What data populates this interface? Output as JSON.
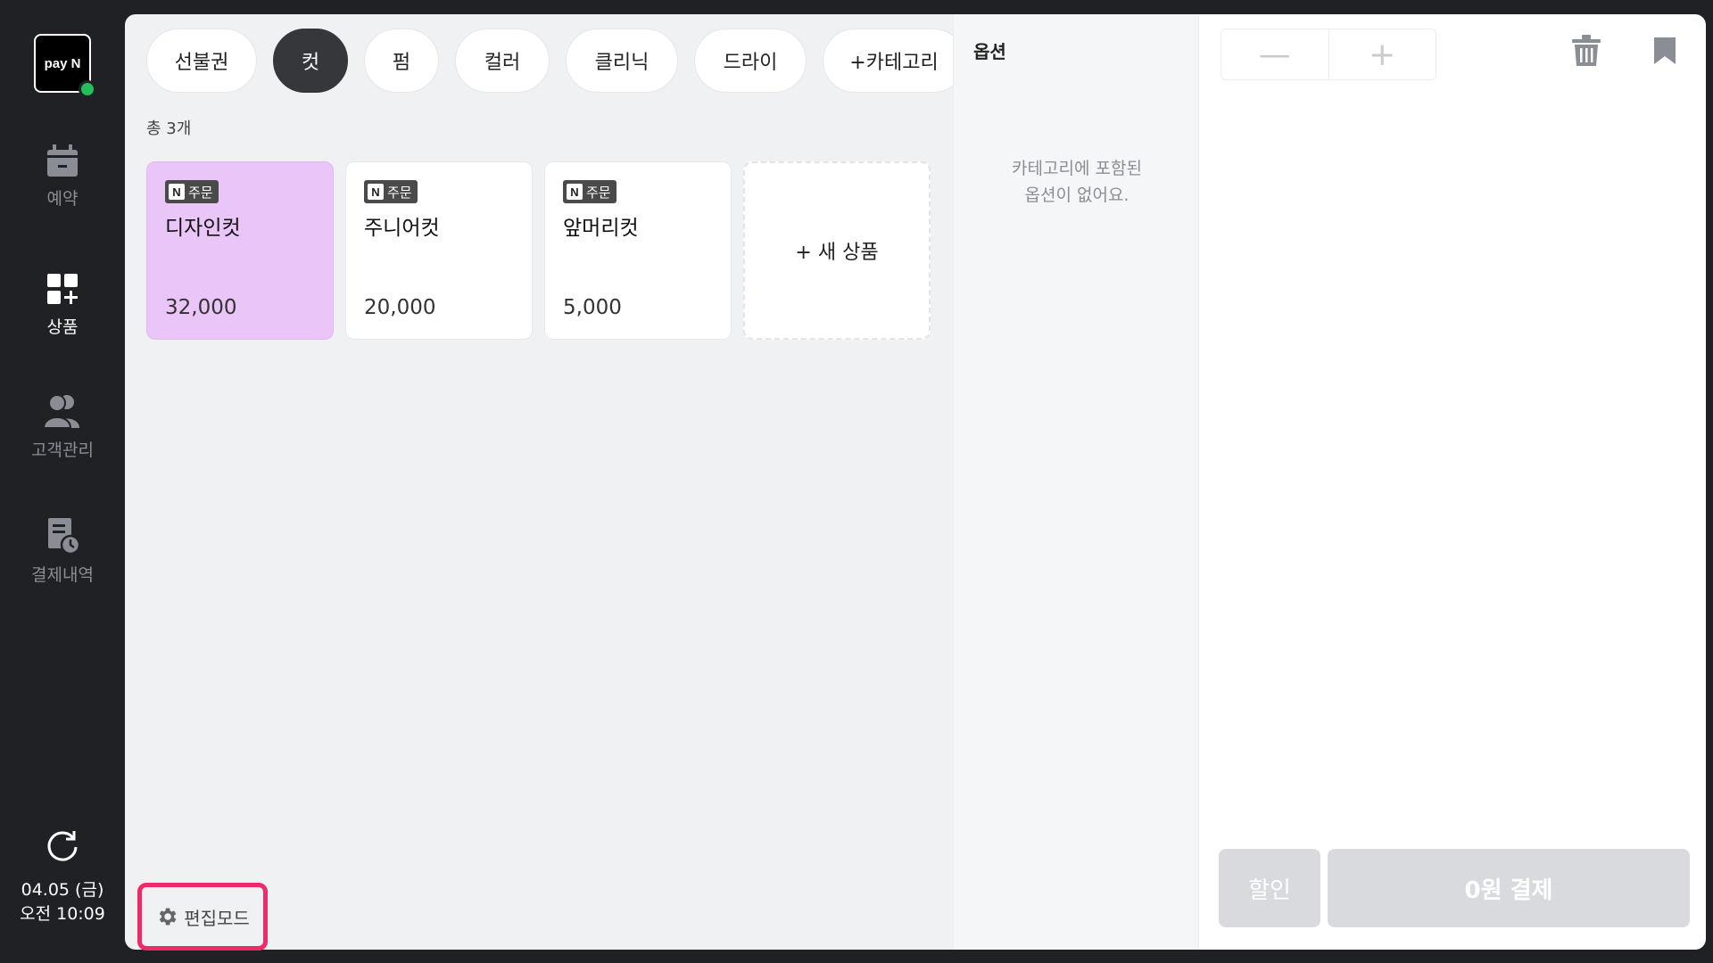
{
  "brand": {
    "logo_text": "pay N",
    "status_color": "#23c05a"
  },
  "sidebar": {
    "items": [
      {
        "label": "예약",
        "icon": "calendar-icon"
      },
      {
        "label": "상품",
        "icon": "product-grid-icon"
      },
      {
        "label": "고객관리",
        "icon": "customers-icon"
      },
      {
        "label": "결제내역",
        "icon": "payment-history-icon"
      }
    ],
    "date": "04.05 (금)",
    "time": "오전 10:09"
  },
  "categories": {
    "tabs": [
      {
        "label": "선불권"
      },
      {
        "label": "컷"
      },
      {
        "label": "펌"
      },
      {
        "label": "컬러"
      },
      {
        "label": "클리닉"
      },
      {
        "label": "드라이"
      },
      {
        "label": "+카테고리"
      }
    ],
    "active": "컷"
  },
  "products": {
    "total_label": "총 3개",
    "badge_label": "주문",
    "badge_letter": "N",
    "items": [
      {
        "name": "디자인컷",
        "price": "32,000",
        "selected": true
      },
      {
        "name": "주니어컷",
        "price": "20,000",
        "selected": false
      },
      {
        "name": "앞머리컷",
        "price": "5,000",
        "selected": false
      }
    ],
    "new_label": "+ 새 상품",
    "selected_color": "#e9c6f7"
  },
  "edit_mode": {
    "label": "편집모드",
    "highlight_color": "#ee2a68"
  },
  "options": {
    "title": "옵션",
    "empty_message": "카테고리에 포함된\n옵션이 없어요."
  },
  "cart": {
    "minus": "—",
    "plus": "+",
    "discount_label": "할인",
    "pay_label": "0원 결제"
  }
}
